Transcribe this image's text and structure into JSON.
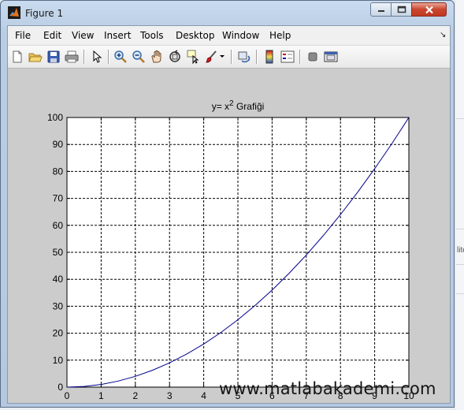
{
  "window": {
    "title": "Figure 1",
    "minimize_icon": "minimize-icon",
    "maximize_icon": "maximize-icon",
    "close_icon": "close-icon"
  },
  "menu": [
    "File",
    "Edit",
    "View",
    "Insert",
    "Tools",
    "Desktop",
    "Window",
    "Help"
  ],
  "toolbar": [
    "new-figure-icon",
    "open-file-icon",
    "save-icon",
    "print-icon",
    "pointer-icon",
    "zoom-in-icon",
    "zoom-out-icon",
    "pan-hand-icon",
    "rotate-3d-icon",
    "data-cursor-icon",
    "brush-icon",
    "link-plot-icon",
    "colorbar-icon",
    "legend-icon",
    "hide-plot-tools-icon",
    "show-plot-tools-icon"
  ],
  "background_fragment": "lite",
  "watermark": "www.matlabakademi.com",
  "colors": {
    "line": "#00008b",
    "figure_bg": "#cccccc",
    "axes_bg": "#ffffff"
  },
  "chart_data": {
    "type": "line",
    "title": "y= x",
    "title_superscript": "2",
    "title_suffix": " Grafiği",
    "xlabel": "",
    "ylabel": "",
    "xlim": [
      0,
      10
    ],
    "ylim": [
      0,
      100
    ],
    "xticks": [
      0,
      1,
      2,
      3,
      4,
      5,
      6,
      7,
      8,
      9,
      10
    ],
    "yticks": [
      0,
      10,
      20,
      30,
      40,
      50,
      60,
      70,
      80,
      90,
      100
    ],
    "grid": true,
    "grid_style": "dashed",
    "series": [
      {
        "x": [
          0,
          0.5,
          1,
          1.5,
          2,
          2.5,
          3,
          3.5,
          4,
          4.5,
          5,
          5.5,
          6,
          6.5,
          7,
          7.5,
          8,
          8.5,
          9,
          9.5,
          10
        ],
        "y": [
          0,
          0.25,
          1,
          2.25,
          4,
          6.25,
          9,
          12.25,
          16,
          20.25,
          25,
          30.25,
          36,
          42.25,
          49,
          56.25,
          64,
          72.25,
          81,
          90.25,
          100
        ]
      }
    ]
  }
}
